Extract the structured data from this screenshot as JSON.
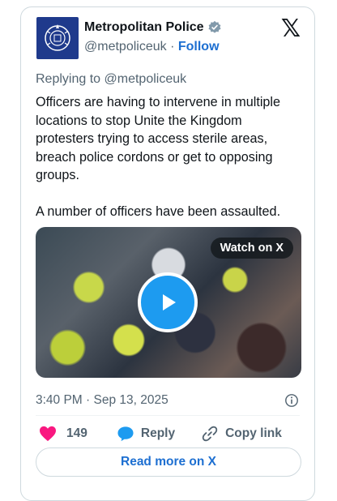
{
  "account": {
    "name": "Metropolitan Police",
    "handle": "@metpoliceuk",
    "separator": "·",
    "follow_label": "Follow",
    "verified": true
  },
  "post": {
    "replying_prefix": "Replying to",
    "replying_handle": "@metpoliceuk",
    "paragraph_1": "Officers are having to intervene in multiple locations to stop Unite the Kingdom protesters trying to access sterile areas, breach police cordons or get to opposing groups.",
    "paragraph_2": "A number of officers have been assaulted.",
    "timestamp": "3:40 PM · Sep 13, 2025"
  },
  "media": {
    "watch_label": "Watch on X"
  },
  "actions": {
    "like_count": "149",
    "reply_label": "Reply",
    "copy_label": "Copy link",
    "read_more_label": "Read more on X"
  },
  "colors": {
    "accent": "#1d6fd1",
    "heart": "#f91880",
    "play": "#1d9bf0",
    "logo_bg": "#1f3a8c"
  }
}
